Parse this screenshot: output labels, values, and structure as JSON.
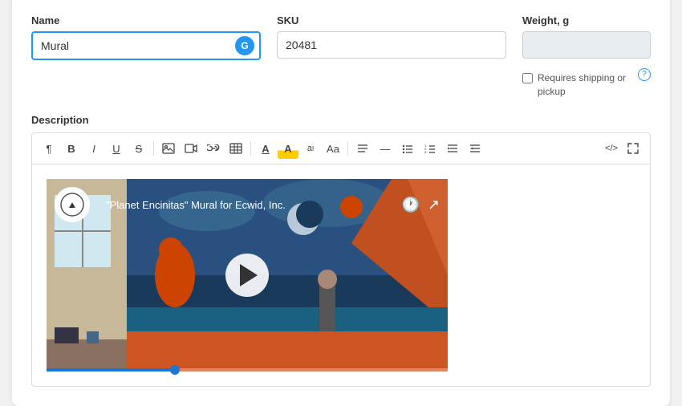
{
  "card": {
    "name_label": "Name",
    "name_value": "Mural",
    "sku_label": "SKU",
    "sku_value": "20481",
    "weight_label": "Weight, g",
    "weight_placeholder": "",
    "requires_shipping_label": "Requires shipping or pickup",
    "description_label": "Description",
    "g_icon_text": "G",
    "info_icon_text": "?",
    "video_title": "\"Planet Encinitas\" Mural for Ecwid, Inc.",
    "toolbar": {
      "paragraph": "¶",
      "bold": "B",
      "italic": "I",
      "underline": "U",
      "strikethrough": "S",
      "image": "🖼",
      "video": "▶",
      "link": "🔗",
      "table": "⊞",
      "text_color": "A",
      "text_bg": "A",
      "special": "aᴵ",
      "case": "Aa",
      "align": "≡",
      "hr": "—",
      "ul": "☰",
      "ol": "☰",
      "indent": "⇥",
      "outdent": "⇤",
      "html": "</>",
      "fullscreen": "⤢"
    }
  }
}
